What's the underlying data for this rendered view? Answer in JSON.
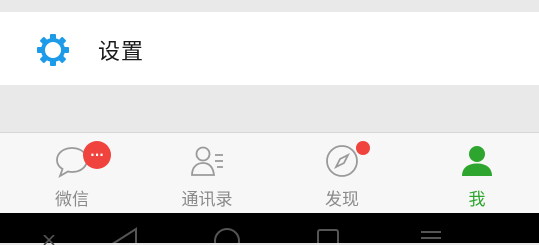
{
  "settings": {
    "label": "设置",
    "icon": "gear-icon",
    "accent": "#1e9be8"
  },
  "tabs": [
    {
      "label": "微信",
      "icon": "chat-bubble-icon",
      "badge": "...",
      "active": false
    },
    {
      "label": "通讯录",
      "icon": "contacts-icon",
      "active": false
    },
    {
      "label": "发现",
      "icon": "compass-icon",
      "dot": true,
      "active": false
    },
    {
      "label": "我",
      "icon": "person-icon",
      "active": true
    }
  ],
  "colors": {
    "active": "#2ea52e",
    "inactive": "#8a8a8a",
    "badge": "#f0433d",
    "background": "#e9e9e9"
  },
  "navbar": {
    "buttons": [
      "dismiss-icon",
      "back-icon",
      "home-icon",
      "recents-icon",
      "menu-icon"
    ]
  }
}
